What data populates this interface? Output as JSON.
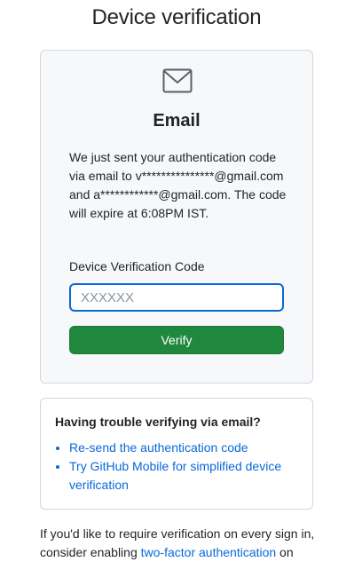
{
  "page": {
    "title": "Device verification"
  },
  "card": {
    "icon": "mail-icon",
    "heading": "Email",
    "message": "We just sent your authentication code via email to v***************@gmail.com and a************@gmail.com. The code will expire at 6:08PM IST.",
    "field_label": "Device Verification Code",
    "code_value": "",
    "code_placeholder": "XXXXXX",
    "verify_label": "Verify"
  },
  "help": {
    "title": "Having trouble verifying via email?",
    "links": [
      "Re-send the authentication code",
      "Try GitHub Mobile for simplified device verification"
    ]
  },
  "footer": {
    "text_before": "If you'd like to require verification on every sign in, consider enabling ",
    "link": "two-factor authentication",
    "text_after": " on"
  },
  "colors": {
    "primary_button": "#1f883d",
    "link": "#0969da",
    "input_focus": "#0969da",
    "card_background": "#f6f8fa",
    "border": "#d0d7de"
  }
}
